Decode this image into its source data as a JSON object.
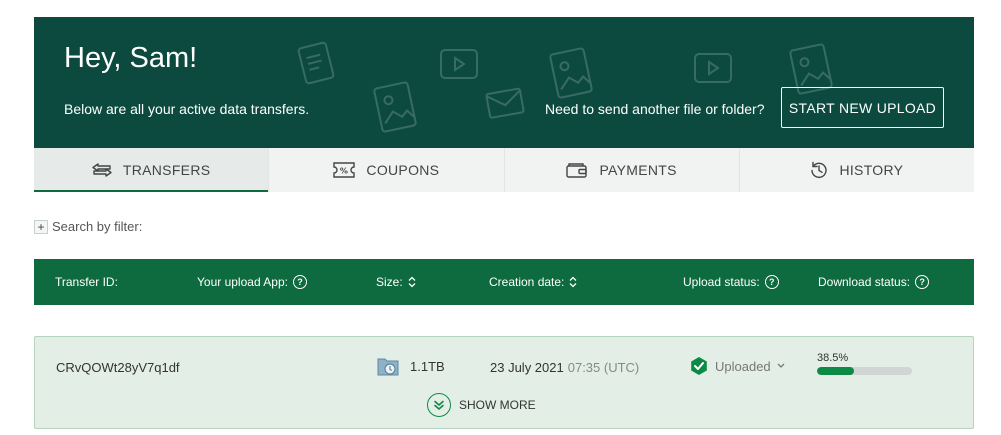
{
  "hero": {
    "greeting": "Hey, Sam!",
    "subtitle": "Below are all your active data transfers.",
    "cta_text": "Need to send another file or folder?",
    "cta_button": "START NEW UPLOAD"
  },
  "tabs": [
    {
      "label": "TRANSFERS",
      "icon": "transfer-arrows-icon",
      "active": true
    },
    {
      "label": "COUPONS",
      "icon": "coupon-icon",
      "active": false
    },
    {
      "label": "PAYMENTS",
      "icon": "wallet-icon",
      "active": false
    },
    {
      "label": "HISTORY",
      "icon": "history-icon",
      "active": false
    }
  ],
  "filter": {
    "label": "Search by filter:",
    "icon": "plus-icon"
  },
  "table": {
    "columns": [
      "Transfer ID:",
      "Your upload App:",
      "Size:",
      "Creation date:",
      "Upload status:",
      "Download status:"
    ],
    "rows": [
      {
        "transfer_id": "CRvQOWt28yV7q1df",
        "size": "1.1TB",
        "date": "23 July 2021",
        "time": "07:35 (UTC)",
        "upload_status": "Uploaded",
        "download_progress_label": "38.5%",
        "download_progress": 0.385
      }
    ],
    "show_more": "SHOW MORE"
  },
  "colors": {
    "hero_bg": "#0c4a40",
    "header_bg": "#0d6b3f",
    "accent": "#0d8a45",
    "row_bg": "#e3efe6"
  }
}
